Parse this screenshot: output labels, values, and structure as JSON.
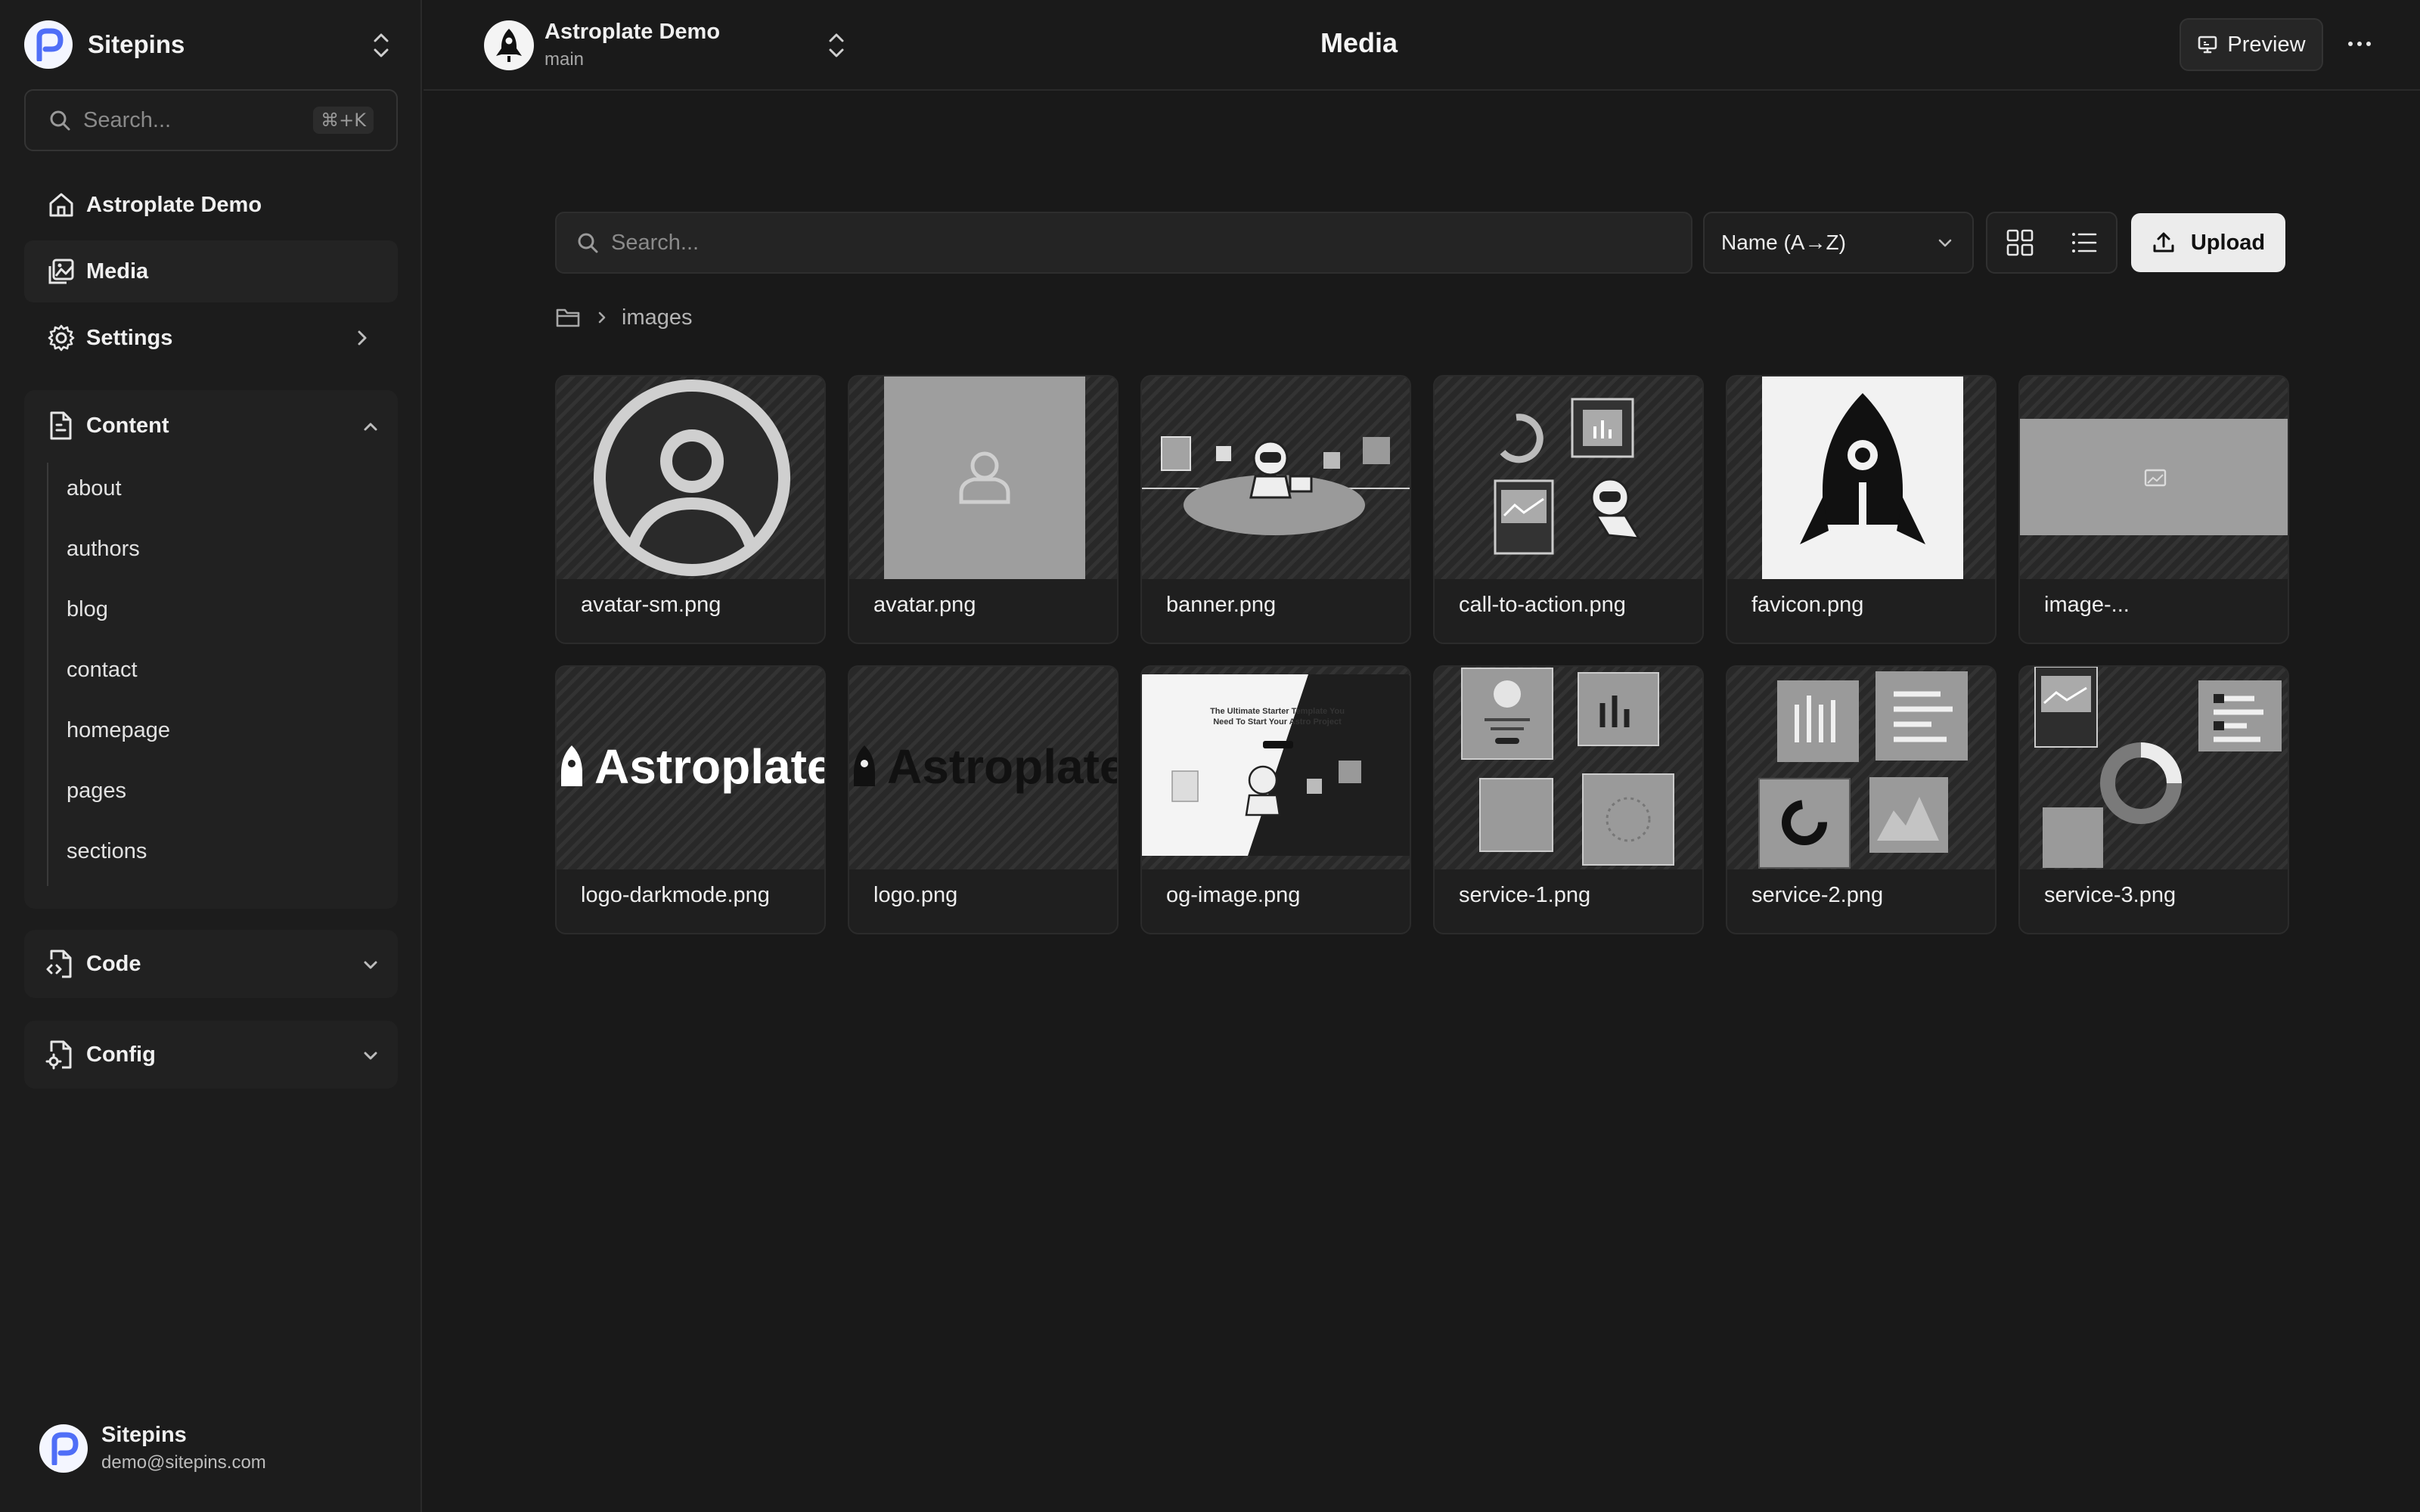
{
  "app": {
    "name": "Sitepins",
    "search_placeholder": "Search...",
    "search_shortcut": "⌘+K"
  },
  "sidebar": {
    "nav": [
      {
        "label": "Astroplate Demo",
        "icon": "home-icon"
      },
      {
        "label": "Media",
        "icon": "media-icon"
      },
      {
        "label": "Settings",
        "icon": "gear-icon"
      }
    ],
    "content": {
      "label": "Content",
      "items": [
        "about",
        "authors",
        "blog",
        "contact",
        "homepage",
        "pages",
        "sections"
      ]
    },
    "code": {
      "label": "Code"
    },
    "config": {
      "label": "Config"
    }
  },
  "user": {
    "name": "Sitepins",
    "email": "demo@sitepins.com"
  },
  "header": {
    "project_name": "Astroplate Demo",
    "branch": "main",
    "title": "Media",
    "preview_label": "Preview"
  },
  "media": {
    "search_placeholder": "Search...",
    "sort_label": "Name (A→Z)",
    "upload_label": "Upload",
    "breadcrumb": "images",
    "files": [
      "avatar-sm.png",
      "avatar.png",
      "banner.png",
      "call-to-action.png",
      "favicon.png",
      "image-...",
      "logo-darkmode.png",
      "logo.png",
      "og-image.png",
      "service-1.png",
      "service-2.png",
      "service-3.png"
    ],
    "logo_text": "Astroplate",
    "og": {
      "heading_line1": "The Ultimate Starter Template You",
      "heading_line2": "Need To Start Your Astro Project"
    }
  },
  "colors": {
    "background": "#191919",
    "sidebar": "#1c1c1c",
    "primary_button": "#ececec",
    "brand_blue": "#4f6ef7"
  }
}
